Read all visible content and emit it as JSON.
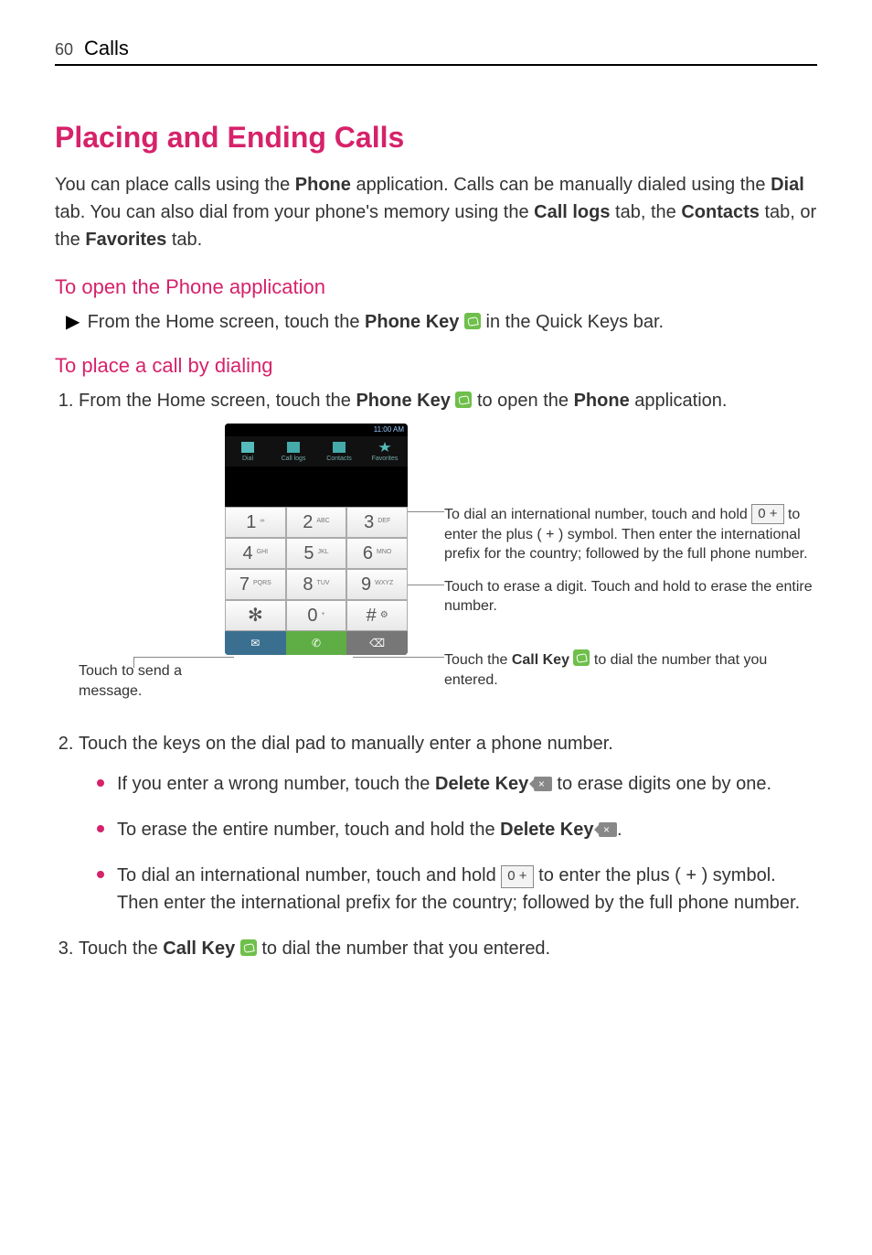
{
  "header": {
    "page_number": "60",
    "section": "Calls"
  },
  "title": "Placing and Ending Calls",
  "intro": {
    "pre": "You can place calls using the ",
    "phone_b": "Phone",
    "mid1": " application. Calls can be manually dialed using the ",
    "dial_b": "Dial",
    "mid2": " tab. You can also dial from your phone's memory using the ",
    "calllogs_b": "Call logs",
    "mid3": " tab, the ",
    "contacts_b": "Contacts",
    "mid4": " tab, or the ",
    "favorites_b": "Favorites",
    "end": " tab."
  },
  "sub1": "To open the Phone application",
  "open_app": {
    "pre": "From the Home screen, touch the ",
    "phonekey_b": "Phone Key",
    "post": " in the Quick Keys bar."
  },
  "sub2": "To place a call by dialing",
  "step1": {
    "pre": "From the Home screen, touch the ",
    "phonekey_b": "Phone Key",
    "mid": " to open the ",
    "phone_b": "Phone",
    "post": " application."
  },
  "figure": {
    "status_time": "11:00 AM",
    "tabs": {
      "dial": "Dial",
      "logs": "Call logs",
      "contacts": "Contacts",
      "fav": "Favorites"
    },
    "keys": {
      "k1": {
        "d": "1",
        "l": "∞"
      },
      "k2": {
        "d": "2",
        "l": "ABC"
      },
      "k3": {
        "d": "3",
        "l": "DEF"
      },
      "k4": {
        "d": "4",
        "l": "GHI"
      },
      "k5": {
        "d": "5",
        "l": "JKL"
      },
      "k6": {
        "d": "6",
        "l": "MNO"
      },
      "k7": {
        "d": "7",
        "l": "PQRS"
      },
      "k8": {
        "d": "8",
        "l": "TUV"
      },
      "k9": {
        "d": "9",
        "l": "WXYZ"
      },
      "kstar": {
        "d": "✻",
        "l": ""
      },
      "k0": {
        "d": "0",
        "l": "+"
      },
      "khash": {
        "d": "#",
        "l": ""
      }
    },
    "callouts": {
      "left_msg": "Touch to send a message.",
      "intl": {
        "pre": "To dial an international number, touch and hold ",
        "zero_label": "0 +",
        "post": " to enter the plus ( + ) symbol. Then enter the international prefix for the country; followed by the full phone number."
      },
      "erase": "Touch to erase a digit. Touch and hold to erase the entire number.",
      "callkey": {
        "pre": "Touch the ",
        "b": "Call Key",
        "post": " to dial the number that you entered."
      }
    }
  },
  "step2": {
    "intro": "Touch the keys on the dial pad to manually enter a phone number.",
    "b1": {
      "pre": "If you enter a wrong number, touch the ",
      "b": "Delete Key",
      "post": " to erase digits one by one."
    },
    "b2": {
      "pre": "To erase the entire number, touch and hold the ",
      "b": "Delete Key",
      "post": "."
    },
    "b3": {
      "pre": "To dial an international number, touch and hold ",
      "zero_label": "0 +",
      "post": " to enter the plus ( + ) symbol. Then enter the international prefix for the country; followed by the full phone number."
    }
  },
  "step3": {
    "pre": "Touch the ",
    "b": "Call Key",
    "post": " to dial the number that you entered."
  }
}
